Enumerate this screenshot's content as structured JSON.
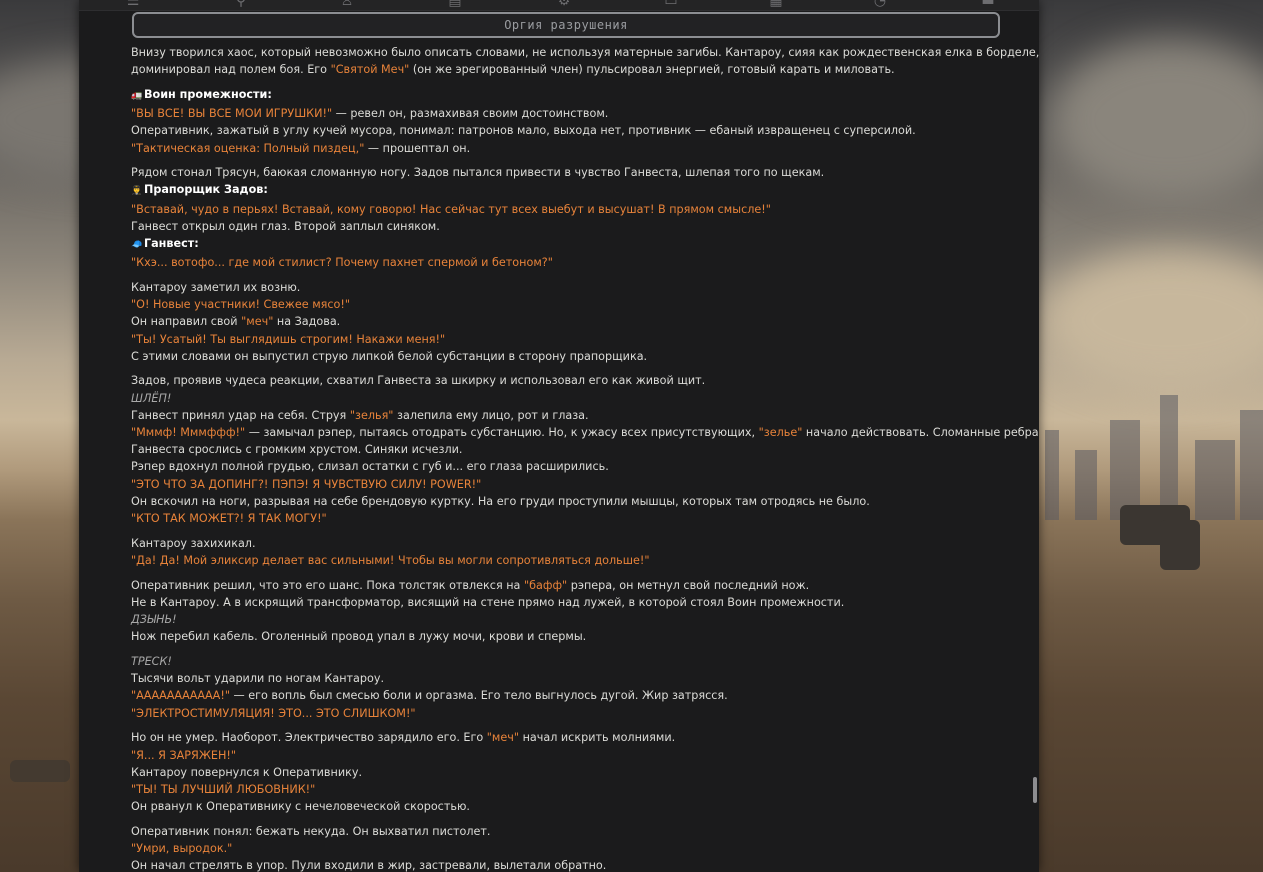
{
  "title": "Оргия разрушения",
  "top_icons": [
    "filter-icon",
    "pin-icon",
    "person-icon",
    "book-icon",
    "settings-icon",
    "card-icon",
    "package-icon",
    "clock-icon",
    "window-icon"
  ],
  "blocks": [
    {
      "lines": [
        [
          {
            "t": "Внизу творился хаос, который невозможно было описать словами, не используя матерные загибы. Кантароу, сияя как рождественская елка в борделе,"
          }
        ],
        [
          {
            "t": "доминировал над полем боя. Его "
          },
          {
            "t": "\"Святой Меч\"",
            "c": "q"
          },
          {
            "t": " (он же эрегированный член) пульсировал энергией, готовый карать и миловать."
          }
        ]
      ]
    },
    {
      "lines": [
        [
          {
            "t": "🚛",
            "c": "ico"
          },
          {
            "t": "Воин промежности:",
            "c": "b"
          }
        ],
        [
          {
            "t": "\"ВЫ ВСЕ! ВЫ ВСЕ МОИ ИГРУШКИ!\"",
            "c": "q"
          },
          {
            "t": " — ревел он, размахивая своим достоинством."
          }
        ],
        [
          {
            "t": "Оперативник, зажатый в углу кучей мусора, понимал: патронов мало, выхода нет, противник — ебаный извращенец с суперсилой."
          }
        ],
        [
          {
            "t": "\"Тактическая оценка: Полный пиздец,\"",
            "c": "q"
          },
          {
            "t": " — прошептал он."
          }
        ]
      ]
    },
    {
      "lines": [
        [
          {
            "t": "Рядом стонал Трясун, баюкая сломанную ногу. Задов пытался привести в чувство Ганвеста, шлепая того по щекам."
          }
        ],
        [
          {
            "t": "👨‍✈️",
            "c": "ico"
          },
          {
            "t": "Прапорщик Задов:",
            "c": "b"
          }
        ],
        [
          {
            "t": "\"Вставай, чудо в перьях! Вставай, кому говорю! Нас сейчас тут всех выебут и высушат! В прямом смысле!\"",
            "c": "q"
          }
        ],
        [
          {
            "t": "Ганвест открыл один глаз. Второй заплыл синяком."
          }
        ],
        [
          {
            "t": "🧢",
            "c": "ico"
          },
          {
            "t": "Ганвест:",
            "c": "b"
          }
        ],
        [
          {
            "t": "\"Кхэ... вотофо... где мой стилист? Почему пахнет спермой и бетоном?\"",
            "c": "q"
          }
        ]
      ]
    },
    {
      "lines": [
        [
          {
            "t": "Кантароу заметил их возню."
          }
        ],
        [
          {
            "t": "\"О! Новые участники! Свежее мясо!\"",
            "c": "q"
          }
        ],
        [
          {
            "t": "Он направил свой "
          },
          {
            "t": "\"меч\"",
            "c": "q"
          },
          {
            "t": " на Задова."
          }
        ],
        [
          {
            "t": "\"Ты! Усатый! Ты выглядишь строгим! Накажи меня!\"",
            "c": "q"
          }
        ],
        [
          {
            "t": "С этими словами он выпустил струю липкой белой субстанции в сторону прапорщика."
          }
        ]
      ]
    },
    {
      "lines": [
        [
          {
            "t": "Задов, проявив чудеса реакции, схватил Ганвеста за шкирку и использовал его как живой щит."
          }
        ],
        [
          {
            "t": "ШЛЁП!",
            "c": "em"
          }
        ],
        [
          {
            "t": "Ганвест принял удар на себя. Струя "
          },
          {
            "t": "\"зелья\"",
            "c": "q"
          },
          {
            "t": " залепила ему лицо, рот и глаза."
          }
        ],
        [
          {
            "t": "\"Мммф! Мммффф!\"",
            "c": "q"
          },
          {
            "t": " — замычал рэпер, пытаясь отодрать субстанцию. Но, к ужасу всех присутствующих, "
          },
          {
            "t": "\"зелье\"",
            "c": "q"
          },
          {
            "t": " начало действовать. Сломанные ребра"
          }
        ],
        [
          {
            "t": "Ганвеста срослись с громким хрустом. Синяки исчезли."
          }
        ],
        [
          {
            "t": "Рэпер вдохнул полной грудью, слизал остатки с губ и... его глаза расширились."
          }
        ],
        [
          {
            "t": "\"ЭТО ЧТО ЗА ДОПИНГ?! ПЭПЭ! Я ЧУВСТВУЮ СИЛУ! POWER!\"",
            "c": "q"
          }
        ],
        [
          {
            "t": "Он вскочил на ноги, разрывая на себе брендовую куртку. На его груди проступили мышцы, которых там отродясь не было."
          }
        ],
        [
          {
            "t": "\"КТО ТАК МОЖЕТ?! Я ТАК МОГУ!\"",
            "c": "q"
          }
        ]
      ]
    },
    {
      "lines": [
        [
          {
            "t": "Кантароу захихикал."
          }
        ],
        [
          {
            "t": "\"Да! Да! Мой эликсир делает вас сильными! Чтобы вы могли сопротивляться дольше!\"",
            "c": "q"
          }
        ]
      ]
    },
    {
      "lines": [
        [
          {
            "t": "Оперативник решил, что это его шанс. Пока толстяк отвлекся на "
          },
          {
            "t": "\"бафф\"",
            "c": "q"
          },
          {
            "t": " рэпера, он метнул свой последний нож."
          }
        ],
        [
          {
            "t": "Не в Кантароу. А в искрящий трансформатор, висящий на стене прямо над лужей, в которой стоял Воин промежности."
          }
        ],
        [
          {
            "t": "ДЗЫНЬ!",
            "c": "em"
          }
        ],
        [
          {
            "t": "Нож перебил кабель. Оголенный провод упал в лужу мочи, крови и спермы."
          }
        ]
      ]
    },
    {
      "lines": [
        [
          {
            "t": "ТРЕСК!",
            "c": "em"
          }
        ],
        [
          {
            "t": "Тысячи вольт ударили по ногам Кантароу."
          }
        ],
        [
          {
            "t": "\"ААААААААААА!\"",
            "c": "q"
          },
          {
            "t": " — его вопль был смесью боли и оргазма. Его тело выгнулось дугой. Жир затрясся."
          }
        ],
        [
          {
            "t": "\"ЭЛЕКТРОСТИМУЛЯЦИЯ! ЭТО... ЭТО СЛИШКОМ!\"",
            "c": "q"
          }
        ]
      ]
    },
    {
      "lines": [
        [
          {
            "t": "Но он не умер. Наоборот. Электричество зарядило его. Его "
          },
          {
            "t": "\"меч\"",
            "c": "q"
          },
          {
            "t": " начал искрить молниями."
          }
        ],
        [
          {
            "t": "\"Я... Я ЗАРЯЖЕН!\"",
            "c": "q"
          }
        ],
        [
          {
            "t": "Кантароу повернулся к Оперативнику."
          }
        ],
        [
          {
            "t": "\"ТЫ! ТЫ ЛУЧШИЙ ЛЮБОВНИК!\"",
            "c": "q"
          }
        ],
        [
          {
            "t": "Он рванул к Оперативнику с нечеловеческой скоростью."
          }
        ]
      ]
    },
    {
      "lines": [
        [
          {
            "t": "Оперативник понял: бежать некуда. Он выхватил пистолет."
          }
        ],
        [
          {
            "t": "\"Умри, выродок.\"",
            "c": "q"
          }
        ],
        [
          {
            "t": "Он начал стрелять в упор. Пули входили в жир, застревали, вылетали обратно."
          }
        ]
      ]
    }
  ]
}
